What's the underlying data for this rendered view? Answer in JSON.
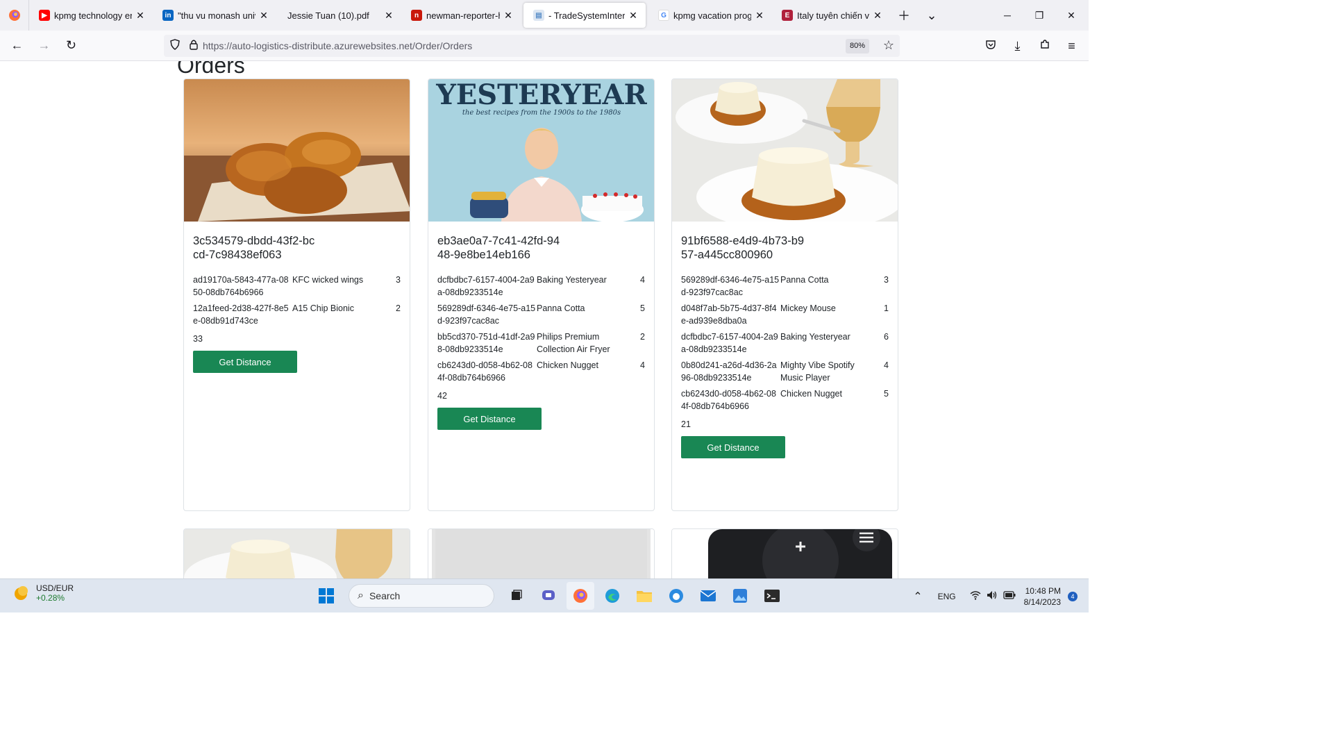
{
  "browser": {
    "tabs": [
      {
        "title": "kpmg technology engi",
        "favicon": "youtube-icon",
        "color": "#ff0000"
      },
      {
        "title": "\"thu vu monash univer",
        "favicon": "linkedin-icon",
        "color": "#0a66c2"
      },
      {
        "title": "Jessie Tuan (10).pdf",
        "favicon": "pdf-icon",
        "color": "#f0f0f4"
      },
      {
        "title": "newman-reporter-htm",
        "favicon": "newman-icon",
        "color": "#c9190b"
      },
      {
        "title": "- TradeSystemInterfac",
        "favicon": "page-icon",
        "color": "#5b8fc9",
        "active": true
      },
      {
        "title": "kpmg vacation progra",
        "favicon": "google-icon",
        "color": "#4285f4"
      },
      {
        "title": "Italy tuyên chiến với cu",
        "favicon": "news-icon",
        "color": "#b0213c"
      }
    ],
    "url_host": "https://auto-logistics-distribute.azurewebsites.net",
    "url_path": "/Order/Orders",
    "zoom": "80%"
  },
  "page": {
    "title": "Orders",
    "button_label": "Get Distance",
    "orders": [
      {
        "id": "3c534579-dbdd-43f2-bccd-7c98438ef063",
        "image": "fried-chicken",
        "items": [
          {
            "product_id": "ad19170a-5843-477a-0850-08db764b6966",
            "name": "KFC wicked wings",
            "qty": "3"
          },
          {
            "product_id": "12a1feed-2d38-427f-8e5e-08db91d743ce",
            "name": "A15 Chip Bionic",
            "qty": "2"
          }
        ],
        "total": "33"
      },
      {
        "id": "eb3ae0a7-7c41-42fd-9448-9e8be14eb166",
        "image": "baking-yesteryear-book",
        "image_text": "YESTERYEAR",
        "image_subtext": "the best recipes from the 1900s to the 1980s",
        "items": [
          {
            "product_id": "dcfbdbc7-6157-4004-2a9a-08db9233514e",
            "name": "Baking Yesteryear",
            "qty": "4"
          },
          {
            "product_id": "569289df-6346-4e75-a15d-923f97cac8ac",
            "name": "Panna Cotta",
            "qty": "5"
          },
          {
            "product_id": "bb5cd370-751d-41df-2a98-08db9233514e",
            "name": "Philips Premium Collection Air Fryer",
            "qty": "2"
          },
          {
            "product_id": "cb6243d0-d058-4b62-084f-08db764b6966",
            "name": "Chicken Nugget",
            "qty": "4"
          }
        ],
        "total": "42"
      },
      {
        "id": "91bf6588-e4d9-4b73-b957-a445cc800960",
        "image": "panna-cotta",
        "items": [
          {
            "product_id": "569289df-6346-4e75-a15d-923f97cac8ac",
            "name": "Panna Cotta",
            "qty": "3"
          },
          {
            "product_id": "d048f7ab-5b75-4d37-8f4e-ad939e8dba0a",
            "name": "Mickey Mouse",
            "qty": "1"
          },
          {
            "product_id": "dcfbdbc7-6157-4004-2a9a-08db9233514e",
            "name": "Baking Yesteryear",
            "qty": "6"
          },
          {
            "product_id": "0b80d241-a26d-4d36-2a96-08db9233514e",
            "name": "Mighty Vibe Spotify Music Player",
            "qty": "4"
          },
          {
            "product_id": "cb6243d0-d058-4b62-084f-08db764b6966",
            "name": "Chicken Nugget",
            "qty": "5"
          }
        ],
        "total": "21"
      }
    ],
    "partial_cards": [
      "panna-cotta",
      "white-product",
      "remote-control"
    ]
  },
  "taskbar": {
    "ticker_label": "USD/EUR",
    "ticker_change": "+0.28%",
    "search_placeholder": "Search",
    "language": "ENG",
    "time": "10:48 PM",
    "date": "8/14/2023",
    "notification_count": "4"
  }
}
